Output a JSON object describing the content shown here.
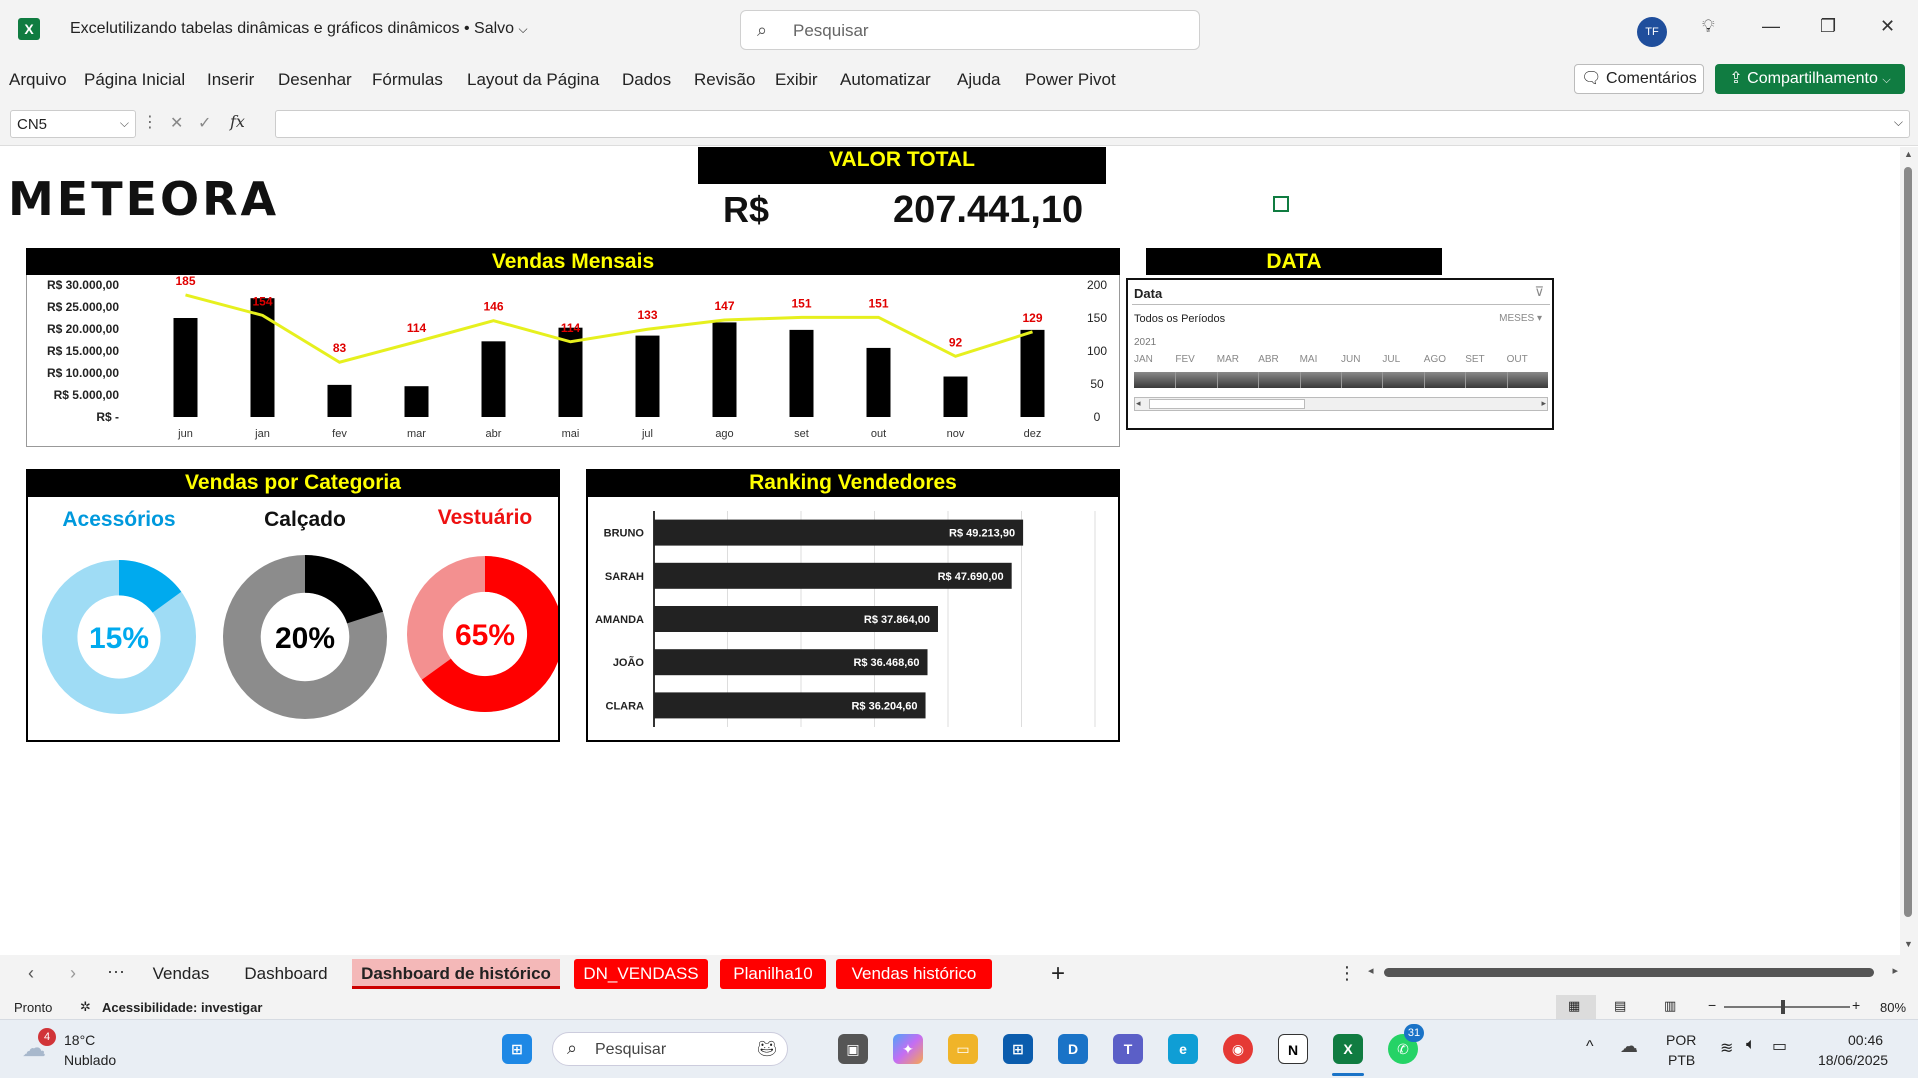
{
  "titlebar": {
    "app_icon": "excel-icon",
    "doc_title": "Excelutilizando tabelas dinâmicas e gráficos dinâmicos • Salvo",
    "search_placeholder": "Pesquisar",
    "avatar_initials": "TF"
  },
  "menu": {
    "items": [
      "Arquivo",
      "Página Inicial",
      "Inserir",
      "Desenhar",
      "Fórmulas",
      "Layout da Página",
      "Dados",
      "Revisão",
      "Exibir",
      "Automatizar",
      "Ajuda",
      "Power Pivot"
    ],
    "comments_label": "Comentários",
    "share_label": "Compartilhamento"
  },
  "formula_bar": {
    "cell_ref": "CN5",
    "formula": ""
  },
  "dashboard": {
    "logo": "METEORA",
    "valor_total_title": "VALOR TOTAL",
    "currency": "R$",
    "valor_total": "207.441,10",
    "vendas_mensais_title": "Vendas Mensais",
    "data_title": "DATA",
    "categoria_title": "Vendas por Categoria",
    "ranking_title": "Ranking Vendedores"
  },
  "timeline": {
    "header": "Data",
    "period_label": "Todos os Períodos",
    "unit_label": "MESES",
    "year": "2021",
    "months": [
      "JAN",
      "FEV",
      "MAR",
      "ABR",
      "MAI",
      "JUN",
      "JUL",
      "AGO",
      "SET",
      "OUT"
    ]
  },
  "chart_data": [
    {
      "type": "bar",
      "title": "Vendas Mensais",
      "categories": [
        "jun",
        "jan",
        "fev",
        "mar",
        "abr",
        "mai",
        "jul",
        "ago",
        "set",
        "out",
        "nov",
        "dez"
      ],
      "series": [
        {
          "values": [
            22500,
            27000,
            7300,
            7000,
            17200,
            20300,
            18500,
            21500,
            19800,
            15700,
            9200,
            19800
          ]
        },
        {
          "values": [
            185,
            154,
            83,
            114,
            146,
            114,
            133,
            147,
            151,
            151,
            92,
            129
          ]
        }
      ],
      "y_left_ticks": [
        "R$ 30.000,00",
        "R$ 25.000,00",
        "R$ 20.000,00",
        "R$ 15.000,00",
        "R$ 10.000,00",
        "R$ 5.000,00",
        "R$ -"
      ],
      "y_left_range": [
        0,
        30000
      ],
      "y_right_ticks": [
        "200",
        "150",
        "100",
        "50",
        "0"
      ],
      "y_right_range": [
        0,
        200
      ],
      "bar_color": "#000000",
      "line_color": "#e6f01e",
      "label_color": "#e00000"
    },
    {
      "type": "pie",
      "title": "Vendas por Categoria",
      "donuts": [
        {
          "name": "Acessórios",
          "value": 15,
          "label": "15%",
          "color": "#00aaee",
          "rest_color": "#9fdcf5",
          "title_color": "#0099dd"
        },
        {
          "name": "Calçado",
          "value": 20,
          "label": "20%",
          "color": "#000000",
          "rest_color": "#8c8c8c",
          "title_color": "#111111"
        },
        {
          "name": "Vestuário",
          "value": 65,
          "label": "65%",
          "color": "#ff0000",
          "rest_color": "#f39090",
          "title_color": "#ee1111"
        }
      ]
    },
    {
      "type": "bar",
      "title": "Ranking Vendedores",
      "orientation": "horizontal",
      "categories": [
        "BRUNO",
        "SARAH",
        "AMANDA",
        "JOÃO",
        "CLARA"
      ],
      "values": [
        49213.9,
        47690.0,
        37864.0,
        36468.6,
        36204.6
      ],
      "labels": [
        "R$ 49.213,90",
        "R$ 47.690,00",
        "R$ 37.864,00",
        "R$ 36.468,60",
        "R$ 36.204,60"
      ],
      "xlim": [
        0,
        60000
      ],
      "bar_color": "#222222"
    }
  ],
  "tabs": {
    "items": [
      {
        "label": "Vendas",
        "style": "plain"
      },
      {
        "label": "Dashboard",
        "style": "plain"
      },
      {
        "label": "Dashboard de histórico",
        "style": "active"
      },
      {
        "label": "DN_VENDASS",
        "style": "red"
      },
      {
        "label": "Planilha10",
        "style": "red"
      },
      {
        "label": "Vendas histórico",
        "style": "red"
      }
    ],
    "add_label": "+"
  },
  "status": {
    "ready": "Pronto",
    "accessibility": "Acessibilidade: investigar",
    "zoom": "80%"
  },
  "taskbar": {
    "weather_temp": "18°C",
    "weather_desc": "Nublado",
    "weather_badge": "4",
    "search_placeholder": "Pesquisar",
    "lang_1": "POR",
    "lang_2": "PTB",
    "time": "00:46",
    "date": "18/06/2025",
    "whatsapp_badge": "31"
  }
}
